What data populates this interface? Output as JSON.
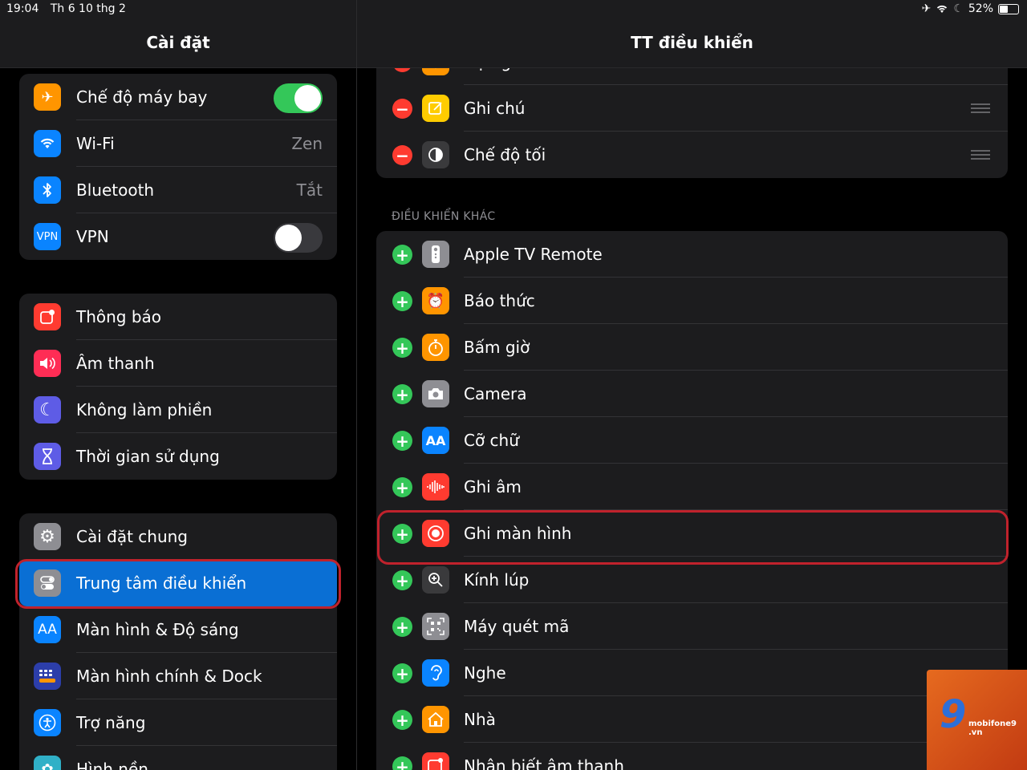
{
  "status": {
    "time": "19:04",
    "date": "Th 6 10 thg 2",
    "battery": "52%",
    "battery_level": 0.52
  },
  "sidebar": {
    "title": "Cài đặt",
    "group1": [
      {
        "label": "Chế độ máy bay",
        "icon": "airplane-icon",
        "toggle": true
      },
      {
        "label": "Wi-Fi",
        "icon": "wifi-icon",
        "value": "Zen"
      },
      {
        "label": "Bluetooth",
        "icon": "bluetooth-icon",
        "value": "Tắt"
      },
      {
        "label": "VPN",
        "icon": "vpn-icon",
        "icon_text": "VPN",
        "toggle": false
      }
    ],
    "group2": [
      {
        "label": "Thông báo",
        "icon": "notifications-icon"
      },
      {
        "label": "Âm thanh",
        "icon": "sounds-icon"
      },
      {
        "label": "Không làm phiền",
        "icon": "moon-icon"
      },
      {
        "label": "Thời gian sử dụng",
        "icon": "hourglass-icon"
      }
    ],
    "group3": [
      {
        "label": "Cài đặt chung",
        "icon": "gear-icon"
      },
      {
        "label": "Trung tâm điều khiển",
        "icon": "control-center-icon",
        "selected": true
      },
      {
        "label": "Màn hình & Độ sáng",
        "icon": "display-icon",
        "icon_text": "AA"
      },
      {
        "label": "Màn hình chính & Dock",
        "icon": "home-screen-icon"
      },
      {
        "label": "Trợ năng",
        "icon": "accessibility-icon"
      },
      {
        "label": "Hình nền",
        "icon": "wallpaper-icon"
      }
    ]
  },
  "detail": {
    "title": "TT điều khiển",
    "included_partial": "Hẹn giờ",
    "included": [
      {
        "label": "Ghi chú",
        "icon": "notes-icon"
      },
      {
        "label": "Chế độ tối",
        "icon": "dark-mode-icon"
      }
    ],
    "more_header": "ĐIỀU KHIỂN KHÁC",
    "more": [
      {
        "label": "Apple TV Remote",
        "icon": "tv-remote-icon"
      },
      {
        "label": "Báo thức",
        "icon": "alarm-icon"
      },
      {
        "label": "Bấm giờ",
        "icon": "stopwatch-icon"
      },
      {
        "label": "Camera",
        "icon": "camera-icon"
      },
      {
        "label": "Cỡ chữ",
        "icon": "text-size-icon",
        "icon_text": "AA"
      },
      {
        "label": "Ghi âm",
        "icon": "voice-memo-icon"
      },
      {
        "label": "Ghi màn hình",
        "icon": "screen-record-icon",
        "highlighted": true
      },
      {
        "label": "Kính lúp",
        "icon": "magnifier-icon"
      },
      {
        "label": "Máy quét mã",
        "icon": "qr-scanner-icon"
      },
      {
        "label": "Nghe",
        "icon": "hearing-icon"
      },
      {
        "label": "Nhà",
        "icon": "home-icon"
      },
      {
        "label": "Nhận biết âm thanh",
        "icon": "sound-recognition-icon"
      }
    ]
  },
  "watermark": {
    "text": "mobifone9",
    "sub": ".vn"
  }
}
